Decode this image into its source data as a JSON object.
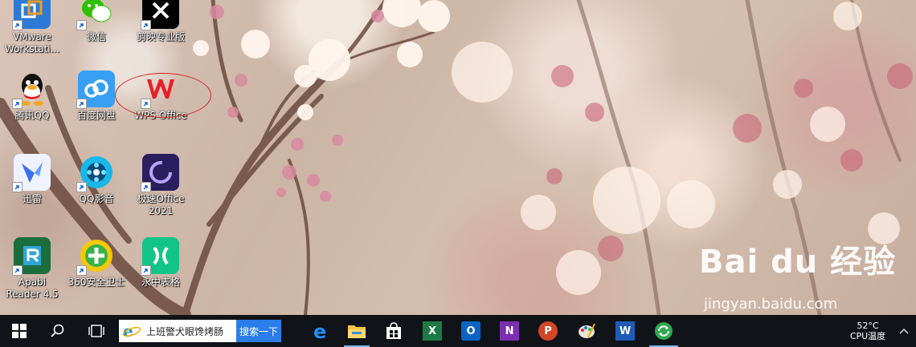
{
  "desktop": {
    "icons": [
      {
        "label": "VMware Workstati...",
        "icon": "vmware-icon"
      },
      {
        "label": "微信",
        "icon": "wechat-icon"
      },
      {
        "label": "剪映专业版",
        "icon": "jianying-icon"
      },
      {
        "label": "腾讯QQ",
        "icon": "qq-icon"
      },
      {
        "label": "百度网盘",
        "icon": "baidu-netdisk-icon"
      },
      {
        "label": "WPS Office",
        "icon": "wps-office-icon"
      },
      {
        "label": "迅雷",
        "icon": "xunlei-icon"
      },
      {
        "label": "QQ影音",
        "icon": "qq-player-icon"
      },
      {
        "label": "极速Office 2021",
        "icon": "jisu-office-icon"
      },
      {
        "label": "Apabi Reader 4.5",
        "icon": "apabi-reader-icon"
      },
      {
        "label": "360安全卫士",
        "icon": "360-safe-icon"
      },
      {
        "label": "永中表格",
        "icon": "yozo-sheet-icon"
      }
    ]
  },
  "watermark": {
    "brand": "Bai du 经验",
    "url": "jingyan.baidu.com"
  },
  "taskbar": {
    "search_text": "上班警犬眼馋烤肠",
    "search_button": "搜索一下",
    "pinned": [
      "edge-icon",
      "file-explorer-icon",
      "store-icon",
      "excel-icon",
      "outlook-icon",
      "onenote-icon",
      "powerpoint-icon",
      "paint-icon",
      "word-icon",
      "refresh-app-icon"
    ],
    "temperature": "52°C",
    "temperature_label": "CPU温度"
  },
  "colors": {
    "taskbar_bg": "#101317",
    "search_button": "#2b7de9",
    "annotation_circle": "#d42525"
  }
}
